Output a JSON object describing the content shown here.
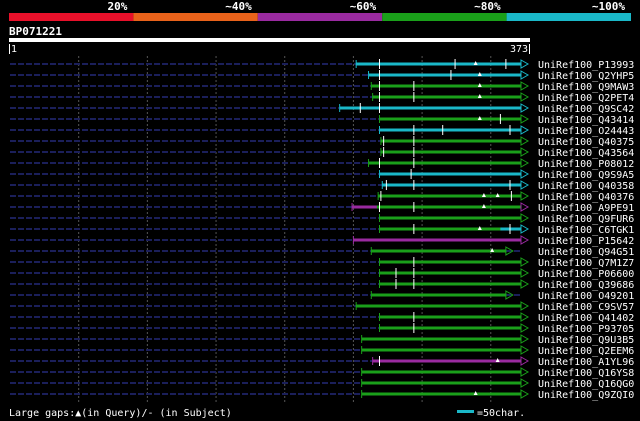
{
  "chart_data": {
    "type": "alignment-overview",
    "query_id": "BP071221",
    "query_start_label": "1",
    "query_end_label": "373",
    "query_length": 373,
    "identity_legend": [
      {
        "label": "20%",
        "color": "#e8102a"
      },
      {
        "label": "~40%",
        "color": "#e8621a"
      },
      {
        "label": "~60%",
        "color": "#9a2aa0"
      },
      {
        "label": "~80%",
        "color": "#1aa01a"
      },
      {
        "label": "~100%",
        "color": "#1ab8c8"
      }
    ],
    "hits": [
      {
        "name": "UniRef100_P13993",
        "start": 253,
        "end": 373,
        "color": "#1ab8c8",
        "ticks": [
          270,
          325,
          362
        ],
        "gap_marks": [
          340
        ]
      },
      {
        "name": "UniRef100_Q2YHP5",
        "start": 262,
        "end": 373,
        "color": "#1ab8c8",
        "ticks": [
          270,
          322
        ],
        "gap_marks": [
          343
        ]
      },
      {
        "name": "UniRef100_Q9MAW3",
        "start": 264,
        "end": 373,
        "color": "#1aa01a",
        "ticks": [
          270,
          295
        ],
        "gap_marks": [
          343
        ]
      },
      {
        "name": "UniRef100_Q2PET4",
        "start": 265,
        "end": 373,
        "color": "#1aa01a",
        "ticks": [
          270,
          295
        ],
        "gap_marks": [
          343
        ]
      },
      {
        "name": "UniRef100_Q9SC42",
        "start": 241,
        "end": 373,
        "color": "#1ab8c8",
        "ticks": [
          256,
          270
        ],
        "gap_marks": []
      },
      {
        "name": "UniRef100_Q43414",
        "start": 270,
        "end": 373,
        "color": "#1aa01a",
        "ticks": [
          358
        ],
        "gap_marks": [
          343
        ]
      },
      {
        "name": "UniRef100_O24443",
        "start": 270,
        "end": 373,
        "color": "#1ab8c8",
        "ticks": [
          295,
          316,
          365
        ],
        "gap_marks": []
      },
      {
        "name": "UniRef100_Q40375",
        "start": 271,
        "end": 373,
        "color": "#1aa01a",
        "ticks": [
          273,
          295
        ],
        "gap_marks": []
      },
      {
        "name": "UniRef100_Q43564",
        "start": 271,
        "end": 373,
        "color": "#1aa01a",
        "ticks": [
          273,
          295
        ],
        "gap_marks": []
      },
      {
        "name": "UniRef100_P08012",
        "start": 262,
        "end": 373,
        "color": "#1aa01a",
        "ticks": [
          270,
          295
        ],
        "gap_marks": []
      },
      {
        "name": "UniRef100_Q9S9A5",
        "start": 270,
        "end": 373,
        "color": "#1ab8c8",
        "ticks": [
          293
        ],
        "gap_marks": []
      },
      {
        "name": "UniRef100_Q40358",
        "start": 272,
        "end": 373,
        "color": "#1ab8c8",
        "ticks": [
          275,
          295,
          365
        ],
        "gap_marks": []
      },
      {
        "name": "UniRef100_Q40376",
        "start": 269,
        "end": 373,
        "color": "#1aa01a",
        "ticks": [
          271,
          366
        ],
        "gap_marks": [
          346,
          356
        ]
      },
      {
        "name": "UniRef100_A9PE91",
        "start": 250,
        "end": 373,
        "color": "#9a2aa0",
        "magenta_end": 268,
        "ticks": [
          270,
          295
        ],
        "gap_marks": [
          346
        ]
      },
      {
        "name": "UniRef100_Q9FUR6",
        "start": 270,
        "end": 373,
        "color": "#1aa01a",
        "ticks": [],
        "gap_marks": []
      },
      {
        "name": "UniRef100_C6TGK1",
        "start": 270,
        "end": 373,
        "color": "#1aa01a",
        "cyan_from": 358,
        "ticks": [
          295,
          365
        ],
        "gap_marks": [
          343
        ]
      },
      {
        "name": "UniRef100_P15642",
        "start": 251,
        "end": 373,
        "color": "#9a2aa0",
        "ticks": [],
        "gap_marks": []
      },
      {
        "name": "UniRef100_Q94G51",
        "start": 264,
        "end": 362,
        "color": "#1aa01a",
        "ticks": [],
        "gap_marks": [
          352
        ]
      },
      {
        "name": "UniRef100_Q7M1Z7",
        "start": 270,
        "end": 373,
        "color": "#1aa01a",
        "ticks": [
          295
        ],
        "gap_marks": []
      },
      {
        "name": "UniRef100_P06600",
        "start": 270,
        "end": 373,
        "color": "#1aa01a",
        "ticks": [
          282,
          295
        ],
        "gap_marks": []
      },
      {
        "name": "UniRef100_Q39686",
        "start": 270,
        "end": 373,
        "color": "#1aa01a",
        "ticks": [
          282,
          295
        ],
        "gap_marks": []
      },
      {
        "name": "UniRef100_O49201",
        "start": 264,
        "end": 362,
        "color": "#1aa01a",
        "ticks": [],
        "gap_marks": []
      },
      {
        "name": "UniRef100_C9SV57",
        "start": 253,
        "end": 373,
        "color": "#1aa01a",
        "ticks": [],
        "gap_marks": []
      },
      {
        "name": "UniRef100_Q41402",
        "start": 270,
        "end": 373,
        "color": "#1aa01a",
        "ticks": [
          295
        ],
        "gap_marks": []
      },
      {
        "name": "UniRef100_P93705",
        "start": 270,
        "end": 373,
        "color": "#1aa01a",
        "ticks": [
          295
        ],
        "gap_marks": []
      },
      {
        "name": "UniRef100_Q9U3B5",
        "start": 257,
        "end": 373,
        "color": "#1aa01a",
        "ticks": [],
        "gap_marks": []
      },
      {
        "name": "UniRef100_Q2EEM6",
        "start": 257,
        "end": 373,
        "color": "#1aa01a",
        "ticks": [],
        "gap_marks": []
      },
      {
        "name": "UniRef100_A1YL96",
        "start": 265,
        "end": 373,
        "color": "#9a2aa0",
        "green_from": 270,
        "ticks": [
          270
        ],
        "gap_marks": [
          356
        ]
      },
      {
        "name": "UniRef100_Q16YS8",
        "start": 257,
        "end": 373,
        "color": "#1aa01a",
        "ticks": [],
        "gap_marks": []
      },
      {
        "name": "UniRef100_Q16QG0",
        "start": 257,
        "end": 373,
        "color": "#1aa01a",
        "ticks": [],
        "gap_marks": []
      },
      {
        "name": "UniRef100_Q9ZQI0",
        "start": 257,
        "end": 373,
        "color": "#1aa01a",
        "ticks": [],
        "gap_marks": [
          340
        ]
      }
    ],
    "footer_gaps_label": "Large gaps:▲(in Query)/- (in Subject)",
    "scale_label": "=50char."
  }
}
